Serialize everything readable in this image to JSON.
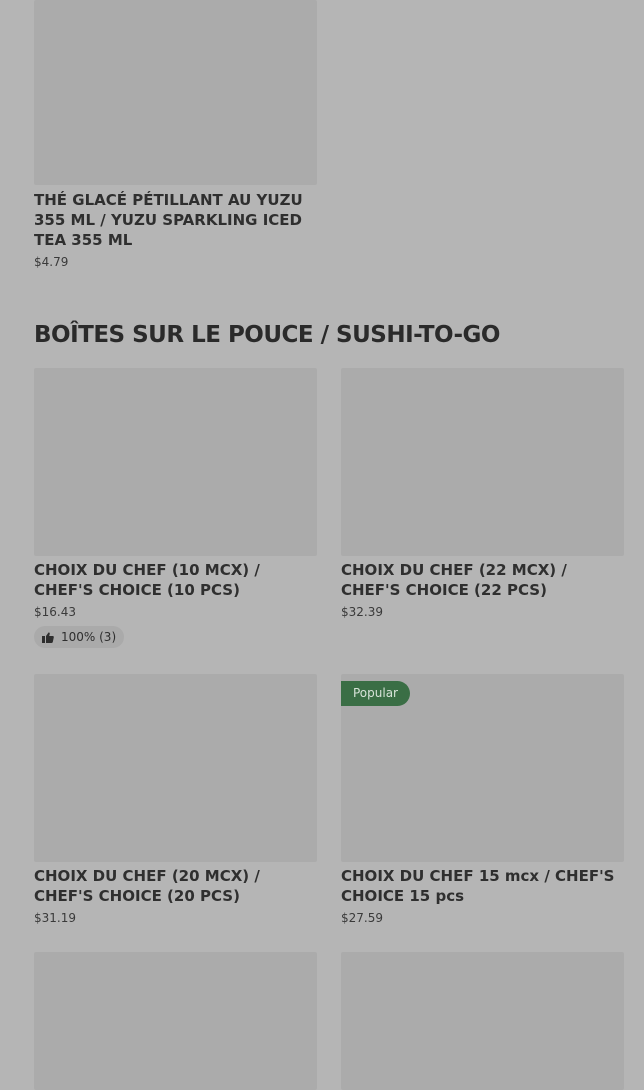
{
  "products_top": [
    {
      "title": "THÉ GLACÉ PÉTILLANT AU YUZU 355 ML / YUZU SPARKLING ICED TEA 355 ML",
      "price": "$4.79"
    }
  ],
  "section": {
    "title": "BOÎTES SUR LE POUCE / SUSHI-TO-GO"
  },
  "products": [
    {
      "title": "CHOIX DU CHEF (10 MCX) / CHEF'S CHOICE (10 PCS)",
      "price": "$16.43",
      "rating": "100% (3)"
    },
    {
      "title": "CHOIX DU CHEF (22 MCX) / CHEF'S CHOICE (22 PCS)",
      "price": "$32.39"
    },
    {
      "title": "CHOIX DU CHEF (20 MCX) / CHEF'S CHOICE (20 PCS)",
      "price": "$31.19"
    },
    {
      "title": "CHOIX DU CHEF 15 mcx / CHEF'S CHOICE 15 pcs",
      "price": "$27.59",
      "badge": "Popular"
    }
  ],
  "icons": {
    "rating": "thumbs-up-icon"
  },
  "colors": {
    "overlay_background": "#b5b5b5",
    "image_placeholder": "#ababab",
    "popular_badge": "#3a6e45"
  }
}
